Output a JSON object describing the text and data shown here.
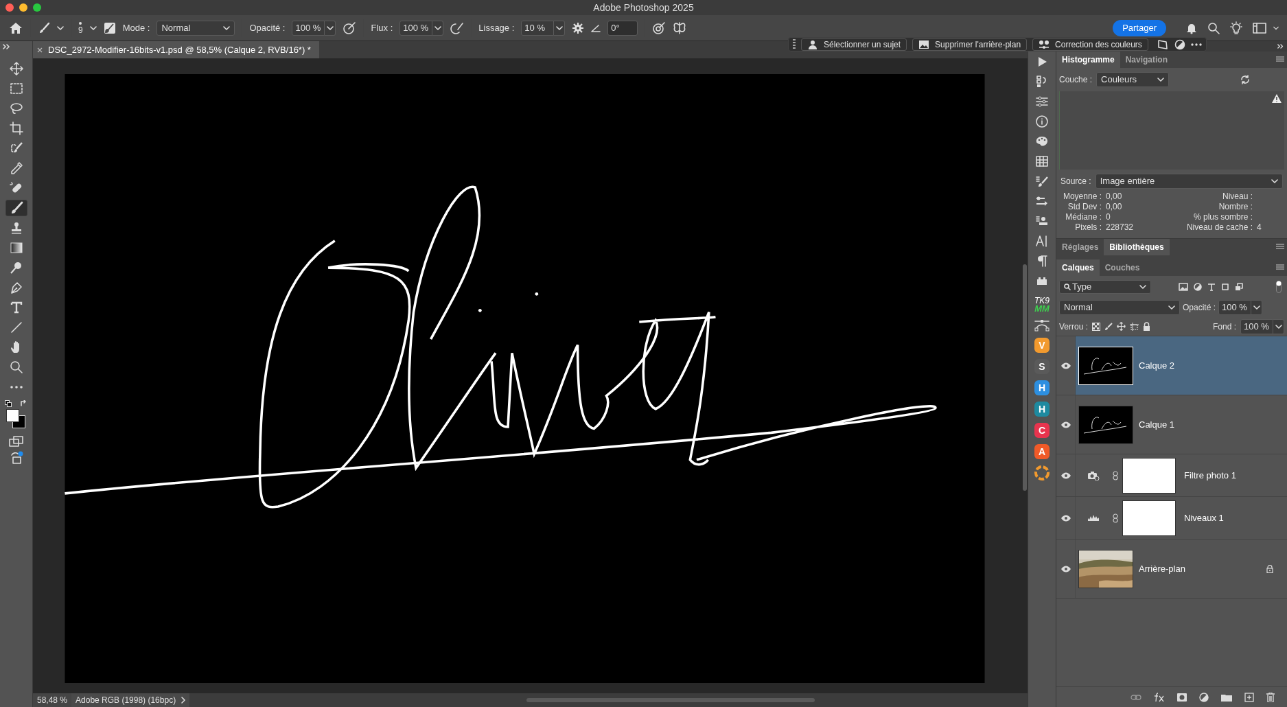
{
  "window": {
    "title": "Adobe Photoshop 2025"
  },
  "options_bar": {
    "brush_size": "9",
    "mode_label": "Mode :",
    "mode": "Normal",
    "opacity_label": "Opacité :",
    "opacity": "100 %",
    "flow_label": "Flux :",
    "flow": "100 %",
    "smoothing_label": "Lissage :",
    "smoothing": "10 %",
    "angle": "0°",
    "share_button": "Partager"
  },
  "contextual_bar": {
    "buttons": [
      {
        "label": "Sélectionner un sujet",
        "kind": "subject"
      },
      {
        "label": "Supprimer l'arrière-plan",
        "kind": "remove-bg"
      },
      {
        "label": "Correction des couleurs",
        "kind": "color"
      }
    ]
  },
  "document_tab": {
    "title": "DSC_2972-Modifier-16bits-v1.psd @ 58,5% (Calque 2, RVB/16*) *"
  },
  "tools": [
    {
      "kind": "move",
      "selected": false
    },
    {
      "kind": "marquee",
      "selected": false
    },
    {
      "kind": "lasso",
      "selected": false
    },
    {
      "kind": "crop",
      "selected": false
    },
    {
      "kind": "object",
      "selected": false
    },
    {
      "kind": "eyedropper",
      "selected": false
    },
    {
      "kind": "heal",
      "selected": false
    },
    {
      "kind": "brush",
      "selected": true
    },
    {
      "kind": "stamp",
      "selected": false
    },
    {
      "kind": "gradient",
      "selected": false
    },
    {
      "kind": "dodge",
      "selected": false
    },
    {
      "kind": "pen",
      "selected": false
    },
    {
      "kind": "type",
      "selected": false
    },
    {
      "kind": "line",
      "selected": false
    },
    {
      "kind": "hand",
      "selected": false
    },
    {
      "kind": "zoom",
      "selected": false
    },
    {
      "kind": "more",
      "selected": false
    }
  ],
  "plugins": [
    {
      "kind": "stacked",
      "lines": [
        "TK9",
        "MM"
      ]
    },
    {
      "kind": "badge",
      "label": "V",
      "color": "#f29a2e"
    },
    {
      "kind": "badge",
      "label": "S",
      "color": "#5a5a5a"
    },
    {
      "kind": "badge",
      "label": "H",
      "color": "#2d8fe0"
    },
    {
      "kind": "badge",
      "label": "H",
      "color": "#1e8aa0"
    },
    {
      "kind": "badge",
      "label": "C",
      "color": "#e8344e"
    },
    {
      "kind": "badge",
      "label": "A",
      "color": "#f05a28"
    },
    {
      "kind": "aperture"
    }
  ],
  "histogram_panel": {
    "tabs": [
      {
        "label": "Histogramme",
        "selected": true
      },
      {
        "label": "Navigation",
        "selected": false
      }
    ],
    "channel_label": "Couche :",
    "channel": "Couleurs",
    "source_label": "Source :",
    "source": "Image entière",
    "stats_left": [
      {
        "label": "Moyenne :",
        "value": "0,00"
      },
      {
        "label": "Std Dev :",
        "value": "0,00"
      },
      {
        "label": "Médiane :",
        "value": "0"
      },
      {
        "label": "Pixels :",
        "value": "228732"
      }
    ],
    "stats_right": [
      {
        "label": "Niveau :"
      },
      {
        "label": "Nombre :"
      },
      {
        "label": "% plus sombre :"
      },
      {
        "label": "Niveau de cache :",
        "value": "4"
      }
    ]
  },
  "adjust_panel": {
    "tabs": [
      {
        "label": "Réglages",
        "selected": false
      },
      {
        "label": "Bibliothèques",
        "selected": true
      }
    ]
  },
  "layers_panel": {
    "tabs": [
      {
        "label": "Calques",
        "selected": true
      },
      {
        "label": "Couches",
        "selected": false
      }
    ],
    "filter": "Type",
    "blend_mode": "Normal",
    "opacity_label": "Opacité :",
    "opacity": "100 %",
    "lock_label": "Verrou :",
    "fill_label": "Fond :",
    "fill": "100 %",
    "layers": [
      {
        "name": "Calque 2",
        "kind": "pixel",
        "selected": true,
        "visible": true,
        "locked": false
      },
      {
        "name": "Calque 1",
        "kind": "pixel",
        "selected": false,
        "visible": true,
        "locked": false
      },
      {
        "name": "Filtre photo 1",
        "kind": "photo_filter",
        "selected": false,
        "visible": true,
        "locked": false
      },
      {
        "name": "Niveaux 1",
        "kind": "levels",
        "selected": false,
        "visible": true,
        "locked": false
      },
      {
        "name": "Arrière-plan",
        "kind": "background",
        "selected": false,
        "visible": true,
        "locked": true
      }
    ]
  },
  "status_bar": {
    "zoom": "58,48 %",
    "profile": "Adobe RGB (1998) (16bpc)"
  }
}
